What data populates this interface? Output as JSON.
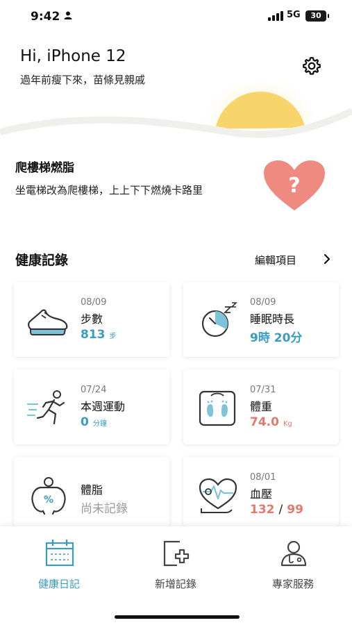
{
  "status_bar": {
    "time": "9:42",
    "network": "5G",
    "battery": "30"
  },
  "header": {
    "greeting": "Hi, iPhone 12",
    "slogan": "過年前瘦下來，苗條見親戚"
  },
  "tip": {
    "title": "爬樓梯燃脂",
    "text": "坐電梯改為爬樓梯，上上下下燃燒卡路里",
    "badge": "?"
  },
  "health": {
    "title": "健康記錄",
    "edit_label": "編輯項目",
    "cards": [
      {
        "date": "08/09",
        "name": "步數",
        "value": "813",
        "unit": "步",
        "icon": "sneaker-icon"
      },
      {
        "date": "08/09",
        "name": "睡眠時長",
        "value": "9時 20分",
        "icon": "sleep-clock-icon"
      },
      {
        "date": "07/24",
        "name": "本週運動",
        "value": "0",
        "unit": "分鐘",
        "icon": "runner-icon"
      },
      {
        "date": "07/31",
        "name": "體重",
        "value": "74.0",
        "unit": "Kg",
        "icon": "scale-icon"
      },
      {
        "name": "體脂",
        "value": "尚未記錄",
        "icon": "body-fat-icon"
      },
      {
        "date": "08/01",
        "name": "血壓",
        "systolic": "132",
        "separator": "/",
        "diastolic": "99",
        "icon": "blood-pressure-icon"
      }
    ]
  },
  "nav": {
    "items": [
      {
        "label": "健康日記",
        "icon": "calendar-icon",
        "active": true
      },
      {
        "label": "新增記錄",
        "icon": "add-record-icon"
      },
      {
        "label": "專家服務",
        "icon": "doctor-icon"
      }
    ]
  },
  "colors": {
    "accent": "#3a9cc0",
    "warning": "#e27a6e",
    "heart": "#ee8a7f",
    "sun": "#f7d56a"
  }
}
